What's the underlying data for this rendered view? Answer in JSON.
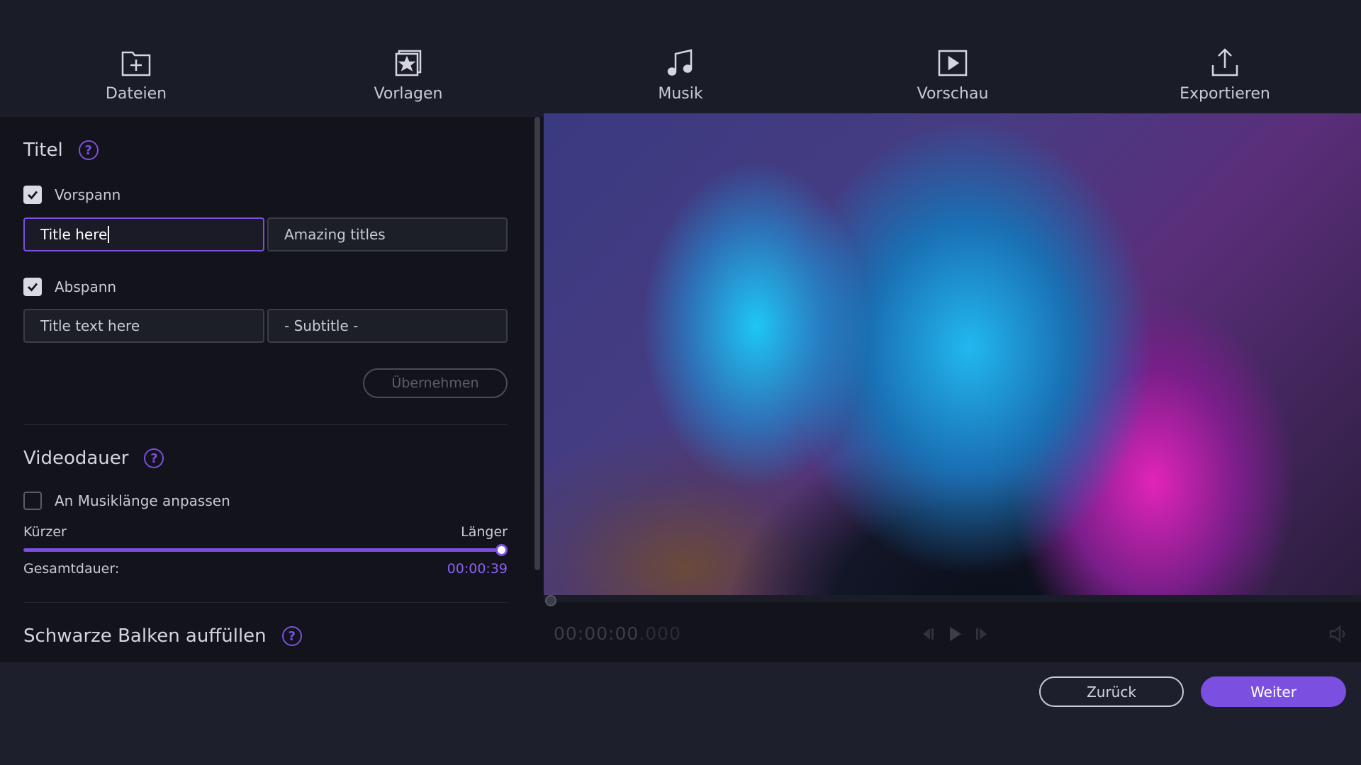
{
  "nav": {
    "items": [
      {
        "label": "Dateien",
        "icon": "folder-plus-icon"
      },
      {
        "label": "Vorlagen",
        "icon": "template-star-icon"
      },
      {
        "label": "Musik",
        "icon": "music-note-icon"
      },
      {
        "label": "Vorschau",
        "icon": "play-preview-icon"
      },
      {
        "label": "Exportieren",
        "icon": "export-upload-icon"
      }
    ]
  },
  "titles": {
    "heading": "Titel",
    "intro": {
      "label": "Vorspann",
      "checked": true,
      "title_value": "Title here",
      "subtitle_value": "Amazing titles"
    },
    "outro": {
      "label": "Abspann",
      "checked": true,
      "title_value": "Title text here",
      "subtitle_value": "- Subtitle -"
    },
    "apply_label": "Übernehmen"
  },
  "duration": {
    "heading": "Videodauer",
    "fit_music_label": "An Musiklänge anpassen",
    "fit_music_checked": false,
    "shorter_label": "Kürzer",
    "longer_label": "Länger",
    "slider_value_fraction": 1.0,
    "total_label": "Gesamtdauer:",
    "total_value": "00:00:39"
  },
  "black_bars": {
    "heading": "Schwarze Balken auffüllen"
  },
  "player": {
    "timecode": "00:00:00",
    "timecode_ms": ".000"
  },
  "footer": {
    "back_label": "Zurück",
    "next_label": "Weiter"
  },
  "colors": {
    "accent": "#7b4fe0",
    "background": "#1a1c28",
    "panel": "#12131b"
  }
}
